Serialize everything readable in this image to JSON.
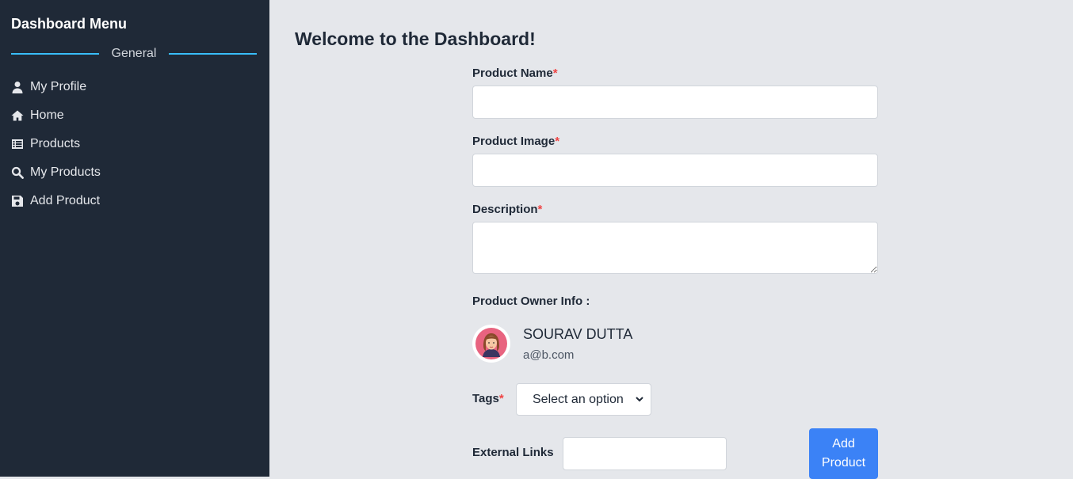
{
  "sidebar": {
    "title": "Dashboard Menu",
    "section": "General",
    "items": [
      {
        "label": "My Profile",
        "icon": "user-icon"
      },
      {
        "label": "Home",
        "icon": "home-icon"
      },
      {
        "label": "Products",
        "icon": "list-icon"
      },
      {
        "label": "My Products",
        "icon": "search-icon"
      },
      {
        "label": "Add Product",
        "icon": "save-icon"
      }
    ]
  },
  "main": {
    "title": "Welcome to the Dashboard!",
    "form": {
      "product_name_label": "Product Name",
      "product_image_label": "Product Image",
      "description_label": "Description",
      "required_mark": "*",
      "owner_info_label": "Product Owner Info :",
      "owner_name": "SOURAV DUTTA",
      "owner_email": "a@b.com",
      "tags_label": "Tags",
      "tags_selected": "Select an option",
      "external_links_label": "External Links",
      "submit_label": "Add Product"
    }
  },
  "colors": {
    "sidebar_bg": "#1f2937",
    "main_bg": "#e5e7eb",
    "accent": "#3b82f6",
    "divider": "#38bdf8",
    "required": "#ef4444"
  }
}
